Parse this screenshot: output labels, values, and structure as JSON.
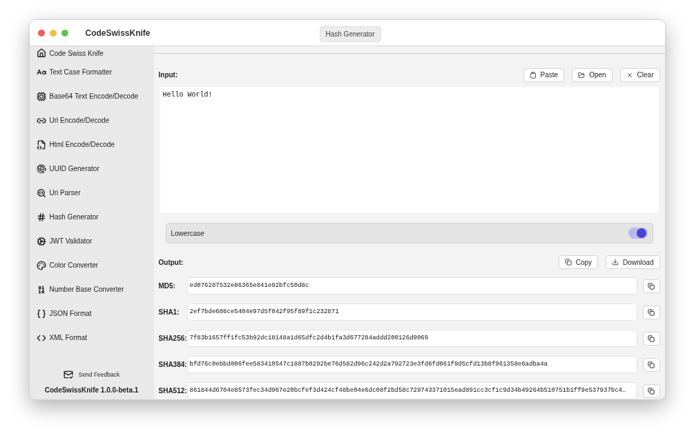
{
  "window": {
    "title": "CodeSwissKnife",
    "current_tool": "Hash Generator"
  },
  "sidebar": {
    "items": [
      "Code Swiss Knife",
      "Text Case Formatter",
      "Base64 Text Encode/Decode",
      "Url Encode/Decode",
      "Html Encode/Decode",
      "UUID Generator",
      "Uri Parser",
      "Hash Generator",
      "JWT Validator",
      "Color Converter",
      "Number Base Converter",
      "JSON Format",
      "XML Format"
    ],
    "feedback": "Send Feedback",
    "version": "CodeSwissKnife 1.0.0-beta.1"
  },
  "input": {
    "label": "Input:",
    "buttons": [
      "Paste",
      "Open",
      "Clear"
    ],
    "value": "Hello World!"
  },
  "lowercase": {
    "label": "Lowercase",
    "on": true
  },
  "output": {
    "label": "Output:",
    "buttons": [
      "Copy",
      "Download"
    ],
    "hashes": [
      {
        "name": "MD5:",
        "value": "ed076287532e86365e841e92bfc50d8c"
      },
      {
        "name": "SHA1:",
        "value": "2ef7bde608ce5404e97d5f042f95f89f1c232871"
      },
      {
        "name": "SHA256:",
        "value": "7f83b1657ff1fc53b92dc18148a1d65dfc2d4b1fa3d677284addd200126d9069"
      },
      {
        "name": "SHA384:",
        "value": "bfd76c0ebbd006fee583410547c1887b0292be76d582d96c242d2a792723e3fd6fd061f9d5cfd13b8f961358e6adba4a"
      },
      {
        "name": "SHA512:",
        "value": "861844d6704e8573fec34d967e20bcfef3d424cf48be04e6dc08f2bd58c729743371015ead891cc3cf1c9d34b49264b510751b1ff9e537937bc4…"
      }
    ]
  }
}
